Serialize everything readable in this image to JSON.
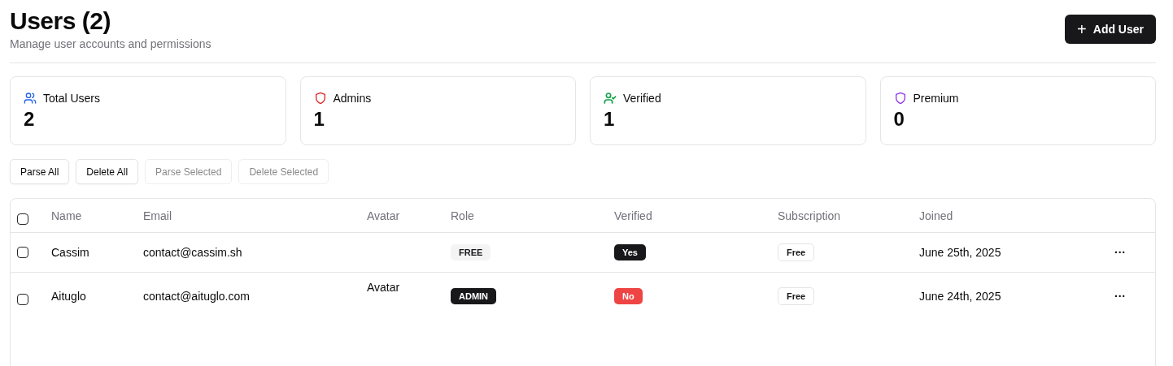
{
  "header": {
    "title": "Users (2)",
    "subtitle": "Manage user accounts and permissions",
    "add_button": {
      "icon": "+",
      "label": "Add User"
    }
  },
  "stats": [
    {
      "kind": "users",
      "label": "Total Users",
      "value": "2",
      "color": "#2563eb"
    },
    {
      "kind": "shield",
      "label": "Admins",
      "value": "1",
      "color": "#dc2626"
    },
    {
      "kind": "user-check",
      "label": "Verified",
      "value": "1",
      "color": "#16a34a"
    },
    {
      "kind": "shield",
      "label": "Premium",
      "value": "0",
      "color": "#9333ea"
    }
  ],
  "actions": [
    {
      "label": "Parse All",
      "disabled": false
    },
    {
      "label": "Delete All",
      "disabled": false
    },
    {
      "label": "Parse Selected",
      "disabled": true
    },
    {
      "label": "Delete Selected",
      "disabled": true
    }
  ],
  "table": {
    "select_all_checked": false,
    "columns": [
      "Name",
      "Email",
      "Avatar",
      "Role",
      "Verified",
      "Subscription",
      "Joined"
    ],
    "rows": [
      {
        "checked": false,
        "name": "Cassim",
        "email": "contact@cassim.sh",
        "avatar": null,
        "role": {
          "kind": "free",
          "label": "FREE"
        },
        "verified": {
          "value": true,
          "label": "Yes"
        },
        "subscription": "Free",
        "joined": "June 25th, 2025",
        "menu": "···"
      },
      {
        "checked": false,
        "name": "Aituglo",
        "email": "contact@aituglo.com",
        "avatar": "Avatar",
        "role": {
          "kind": "admin",
          "label": "ADMIN"
        },
        "verified": {
          "value": false,
          "label": "No"
        },
        "subscription": "Free",
        "joined": "June 24th, 2025",
        "menu": "···"
      }
    ]
  }
}
